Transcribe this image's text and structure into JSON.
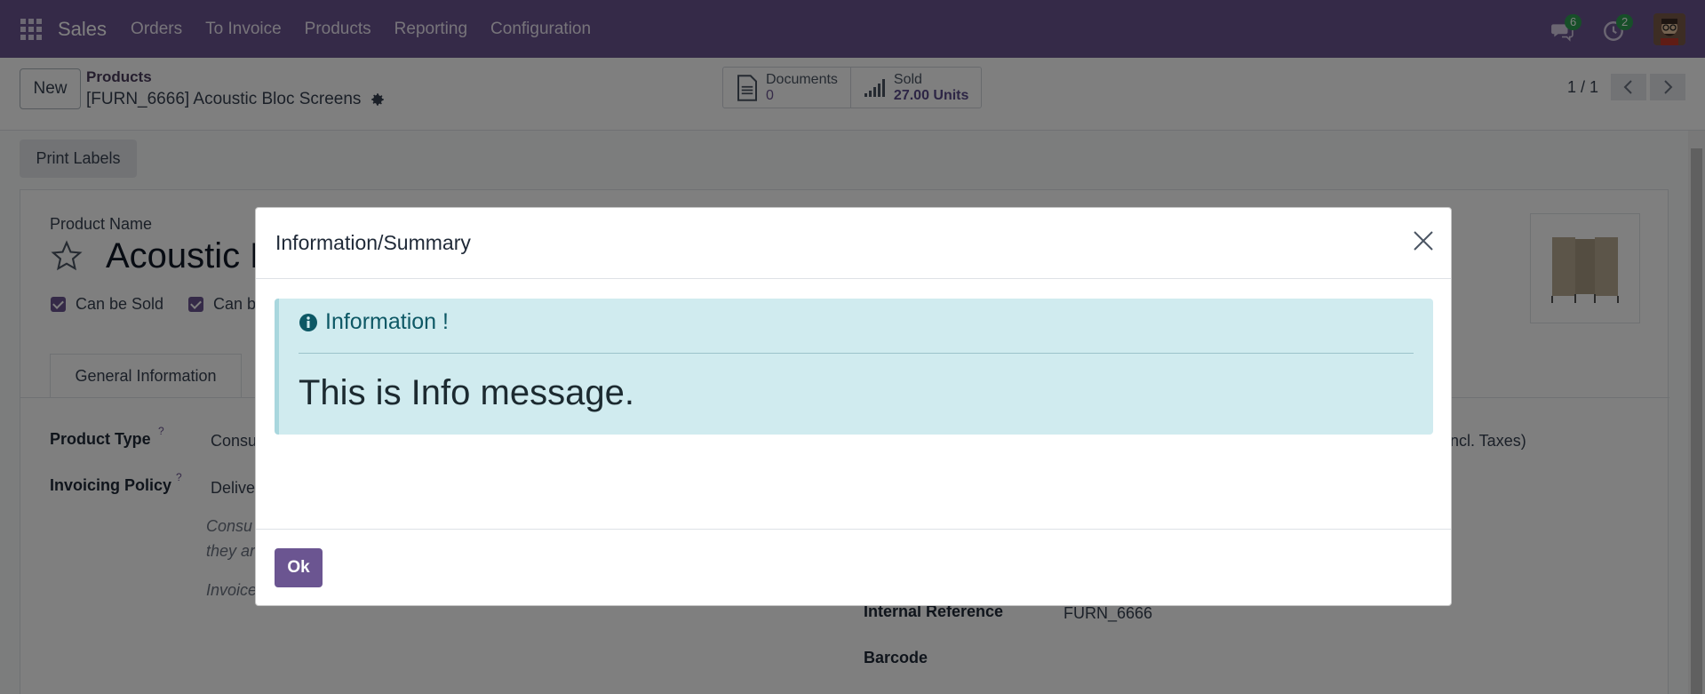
{
  "navbar": {
    "brand": "Sales",
    "menu": [
      "Orders",
      "To Invoice",
      "Products",
      "Reporting",
      "Configuration"
    ],
    "messages_badge": "6",
    "activities_badge": "2",
    "accent": "#6b5591"
  },
  "control_panel": {
    "new_label": "New",
    "breadcrumb_parent": "Products",
    "breadcrumb_current": "[FURN_6666] Acoustic Bloc Screens",
    "smart_buttons": [
      {
        "title": "Documents",
        "value": "0"
      },
      {
        "title": "Sold",
        "value": "27.00 Units"
      }
    ],
    "pager": "1 / 1"
  },
  "form": {
    "print_labels": "Print Labels",
    "product_name_label": "Product Name",
    "product_name_value": "Acoustic B",
    "can_be_sold": "Can be Sold",
    "can_be_purchased": "Can b",
    "tab_general": "General Information",
    "product_type_label": "Product Type",
    "product_type_value": "Consu",
    "invoicing_policy_label": "Invoicing Policy",
    "invoicing_policy_value": "Delive",
    "help_line1": "Consu",
    "help_line2": "they ar",
    "help_line3": "Invoice",
    "help_question": "?",
    "incl_taxes": "ncl. Taxes)",
    "internal_reference_label": "Internal Reference",
    "internal_reference_value": "FURN_6666",
    "barcode_label": "Barcode"
  },
  "modal": {
    "title": "Information/Summary",
    "alert_heading": "Information !",
    "alert_message": "This is Info message.",
    "ok_label": "Ok",
    "alert_bg": "#d0ebef"
  }
}
